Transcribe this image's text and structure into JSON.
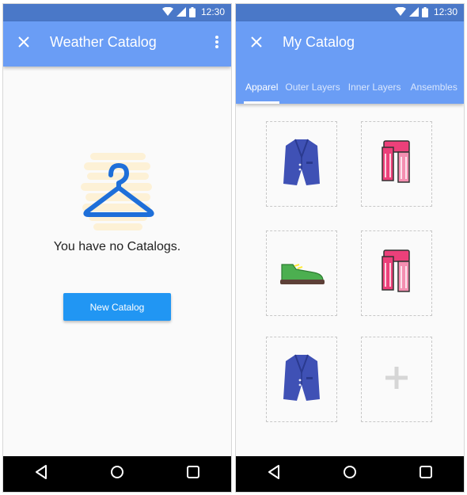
{
  "status_bar": {
    "time": "12:30"
  },
  "left_screen": {
    "app_bar": {
      "title": "Weather Catalog",
      "close_icon": "close-icon",
      "more_icon": "more-vert-icon"
    },
    "empty_state": {
      "icon": "hanger-icon",
      "message": "You have no Catalogs.",
      "button_label": "New Catalog"
    }
  },
  "right_screen": {
    "app_bar": {
      "title": "My Catalog",
      "close_icon": "close-icon"
    },
    "tabs": [
      {
        "label": "Apparel",
        "active": true
      },
      {
        "label": "Outer Layers",
        "active": false
      },
      {
        "label": "Inner Layers",
        "active": false
      },
      {
        "label": "Ansembles",
        "active": false
      }
    ],
    "items": [
      {
        "icon": "blazer-icon",
        "color": "#3f51b5"
      },
      {
        "icon": "scarf-icon",
        "color": "#e91e63"
      },
      {
        "icon": "shoe-icon",
        "color": "#4caf50"
      },
      {
        "icon": "scarf-icon",
        "color": "#e91e63"
      },
      {
        "icon": "blazer-icon",
        "color": "#3f51b5"
      },
      {
        "icon": "add-icon",
        "color": "#d6d6d6"
      }
    ]
  },
  "nav_bar": {
    "back_icon": "back-icon",
    "home_icon": "home-icon",
    "recents_icon": "recents-icon"
  },
  "colors": {
    "status_bar": "#4a78c8",
    "app_bar": "#6a9df5",
    "button": "#2196f3"
  }
}
